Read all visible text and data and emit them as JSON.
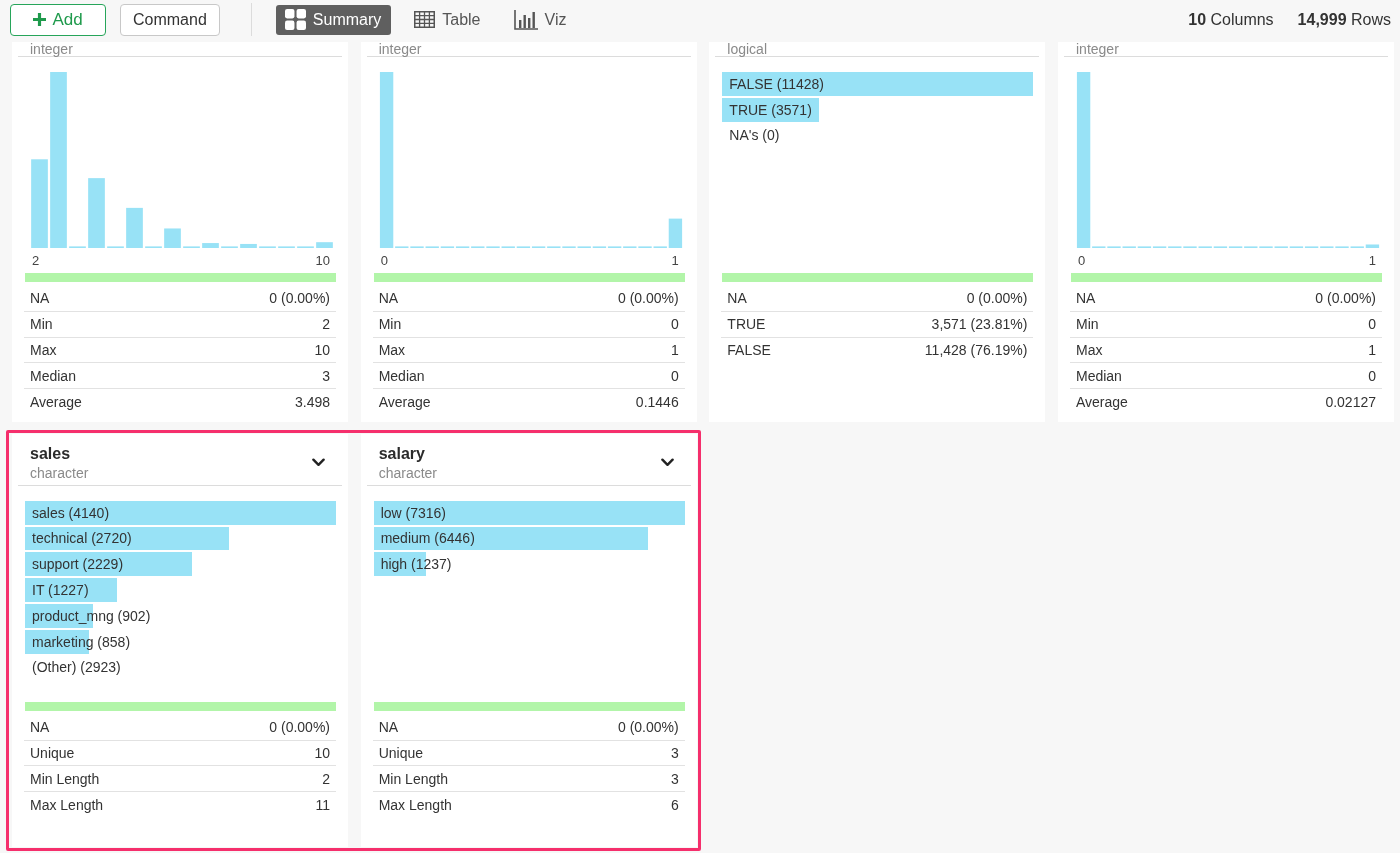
{
  "toolbar": {
    "buttons": [
      {
        "label": "Add",
        "kind": "add"
      },
      {
        "label": "Command",
        "kind": "plain"
      }
    ],
    "view_tabs": [
      {
        "label": "Summary",
        "selected": true
      },
      {
        "label": "Table",
        "selected": false
      },
      {
        "label": "Viz",
        "selected": false
      }
    ],
    "counts": [
      "**10** Columns",
      "**14,999** Rows"
    ]
  },
  "column_cards_row_1": [
    {
      "type": "integer",
      "kind": "histogram",
      "axis_min": "2",
      "axis_max": "10",
      "valid_bar": {
        "level": 1
      },
      "stats": [
        {
          "label": "NA",
          "value": "0 (0.00%)"
        },
        {
          "label": "Min",
          "value": "2"
        },
        {
          "label": "Max",
          "value": "10"
        },
        {
          "label": "Median",
          "value": "3"
        },
        {
          "label": "Average",
          "value": "3.498"
        }
      ]
    },
    {
      "type": "integer",
      "kind": "histogram",
      "axis_min": "0",
      "axis_max": "1",
      "valid_bar": {
        "level": 1
      },
      "stats": [
        {
          "label": "NA",
          "value": "0 (0.00%)"
        },
        {
          "label": "Min",
          "value": "0"
        },
        {
          "label": "Max",
          "value": "1"
        },
        {
          "label": "Median",
          "value": "0"
        },
        {
          "label": "Average",
          "value": "0.1446"
        }
      ]
    },
    {
      "type": "logical",
      "kind": "categories",
      "categories": [
        {
          "label": "FALSE (11428)",
          "level": 1
        },
        {
          "label": "TRUE (3571)",
          "level": 0.312
        },
        {
          "label": "NA's (0)"
        }
      ],
      "valid_bar": {
        "level": 1
      },
      "stats": [
        {
          "label": "NA",
          "value": "0 (0.00%)"
        },
        {
          "label": "TRUE",
          "value": "3,571 (23.81%)"
        },
        {
          "label": "FALSE",
          "value": "11,428 (76.19%)"
        }
      ]
    },
    {
      "type": "integer",
      "kind": "histogram",
      "axis_min": "0",
      "axis_max": "1",
      "valid_bar": {
        "level": 1
      },
      "stats": [
        {
          "label": "NA",
          "value": "0 (0.00%)"
        },
        {
          "label": "Min",
          "value": "0"
        },
        {
          "label": "Max",
          "value": "1"
        },
        {
          "label": "Median",
          "value": "0"
        },
        {
          "label": "Average",
          "value": "0.02127"
        }
      ]
    }
  ],
  "column_cards_row_2": {
    "highlighted": true,
    "cards": [
      {
        "name": "sales",
        "type": "character",
        "kind": "categories",
        "categories": [
          {
            "label": "sales (4140)",
            "level": 1
          },
          {
            "label": "technical (2720)",
            "level": 0.657
          },
          {
            "label": "support (2229)",
            "level": 0.538
          },
          {
            "label": "IT (1227)",
            "level": 0.296
          },
          {
            "label": "product_mng (902)",
            "level": 0.218
          },
          {
            "label": "marketing (858)",
            "level": 0.207
          },
          {
            "label": "(Other) (2923)"
          }
        ],
        "valid_bar": {
          "level": 1
        },
        "stats": [
          {
            "label": "NA",
            "value": "0 (0.00%)"
          },
          {
            "label": "Unique",
            "value": "10"
          },
          {
            "label": "Min Length",
            "value": "2"
          },
          {
            "label": "Max Length",
            "value": "11"
          }
        ]
      },
      {
        "name": "salary",
        "type": "character",
        "kind": "categories",
        "categories": [
          {
            "label": "low (7316)",
            "level": 1
          },
          {
            "label": "medium (6446)",
            "level": 0.881
          },
          {
            "label": "high (1237)",
            "level": 0.169
          }
        ],
        "valid_bar": {
          "level": 1
        },
        "stats": [
          {
            "label": "NA",
            "value": "0 (0.00%)"
          },
          {
            "label": "Unique",
            "value": "3"
          },
          {
            "label": "Min Length",
            "value": "3"
          },
          {
            "label": "Max Length",
            "value": "6"
          }
        ]
      }
    ]
  }
}
